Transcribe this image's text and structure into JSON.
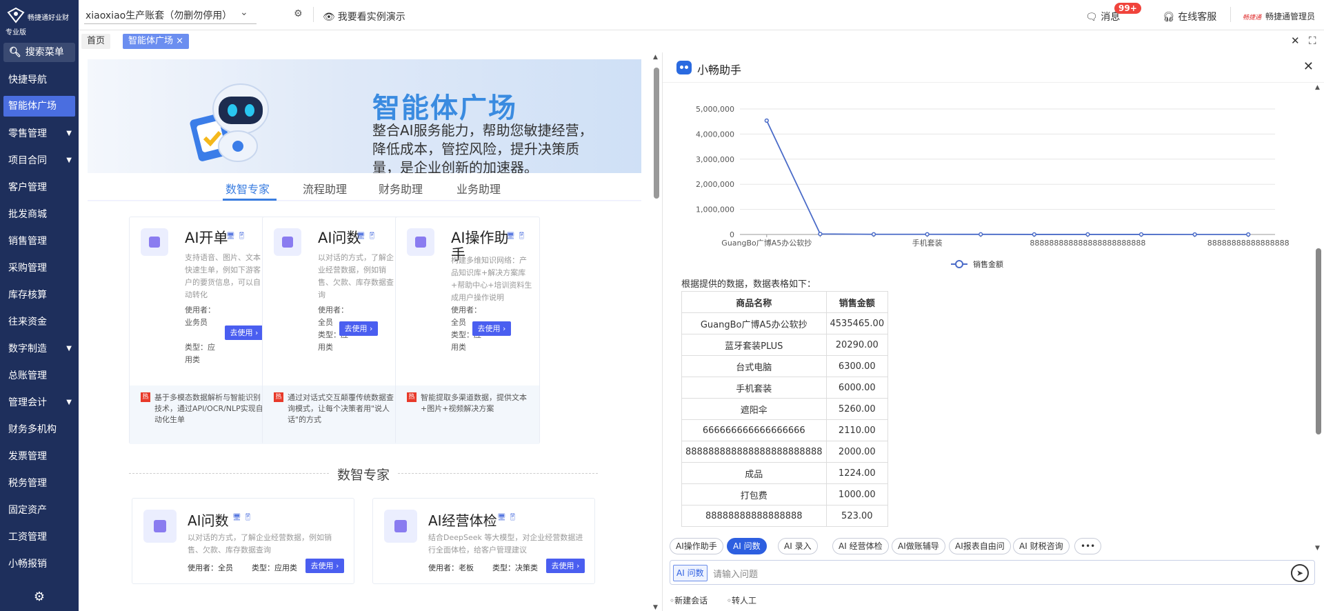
{
  "sidebar": {
    "brand": "畅捷通好业财",
    "edition": "专业版",
    "search_label": "搜索菜单",
    "items": [
      {
        "label": "快捷导航",
        "has_caret": false
      },
      {
        "label": "智能体广场",
        "has_caret": false
      },
      {
        "label": "零售管理",
        "has_caret": true
      },
      {
        "label": "项目合同",
        "has_caret": true
      },
      {
        "label": "客户管理",
        "has_caret": false
      },
      {
        "label": "批发商城",
        "has_caret": false
      },
      {
        "label": "销售管理",
        "has_caret": false
      },
      {
        "label": "采购管理",
        "has_caret": false
      },
      {
        "label": "库存核算",
        "has_caret": false
      },
      {
        "label": "往来资金",
        "has_caret": false
      },
      {
        "label": "数字制造",
        "has_caret": true
      },
      {
        "label": "总账管理",
        "has_caret": false
      },
      {
        "label": "管理会计",
        "has_caret": true
      },
      {
        "label": "财务多机构",
        "has_caret": false
      },
      {
        "label": "发票管理",
        "has_caret": false
      },
      {
        "label": "税务管理",
        "has_caret": false
      },
      {
        "label": "固定资产",
        "has_caret": false
      },
      {
        "label": "工资管理",
        "has_caret": false
      },
      {
        "label": "小畅报销",
        "has_caret": false
      }
    ]
  },
  "topbar": {
    "account": "xiaoxiao生产账套（勿删勿停用）",
    "demo": "我要看实例演示",
    "messages": "消息",
    "messages_badge": "99+",
    "service": "在线客服",
    "user_logo": "畅捷通",
    "user": "畅捷通管理员"
  },
  "tabs": {
    "home": "首页",
    "active": "智能体广场"
  },
  "banner": {
    "title": "智能体广场",
    "desc": "整合AI服务能力，帮助您敏捷经营，降低成本，管控风险，提升决策质量，是企业创新的加速器。"
  },
  "subtabs": [
    "数智专家",
    "流程助理",
    "财务助理",
    "业务助理"
  ],
  "cards": [
    {
      "title": "AI开单",
      "desc": "支持语音、图片、文本快速生单，例如下游客户的要货信息，可以自动转化",
      "user": "使用者：业务员",
      "type": "类型：应用类",
      "use": "去使用",
      "hot": "基于多模态数据解析与智能识别技术，通过API/OCR/NLP实现自动化生单"
    },
    {
      "title": "AI问数",
      "desc": "以对话的方式，了解企业经营数据，例如销售、欠款、库存数据查询",
      "user": "使用者：全员",
      "type": "类型：应用类",
      "use": "去使用",
      "hot": "通过对话式交互颠覆传统数据查询模式，让每个决策者用\"说人话\"的方式"
    },
    {
      "title": "AI操作助手",
      "desc": "构建多维知识网络：产品知识库+解决方案库+帮助中心+培训资料生成用户操作说明",
      "user": "使用者：全员",
      "type": "类型：应用类",
      "use": "去使用",
      "hot": "智能提取多渠道数据，提供文本+图片+视频解决方案"
    }
  ],
  "section_title": "数智专家",
  "cards2": [
    {
      "title": "AI问数",
      "desc": "以对话的方式，了解企业经营数据，例如销售、欠款、库存数据查询",
      "user": "使用者：全员",
      "type": "类型：应用类",
      "use": "去使用"
    },
    {
      "title": "AI经营体检",
      "desc": "结合DeepSeek 等大模型，对企业经营数据进行全面体检，给客户管理建议",
      "user": "使用者：老板",
      "type": "类型：决策类",
      "use": "去使用"
    }
  ],
  "assistant": {
    "title": "小畅助手",
    "intro": "根据提供的数据，数据表格如下：",
    "table_headers": [
      "商品名称",
      "销售金额"
    ],
    "table_rows": [
      [
        "GuangBo广博A5办公软抄",
        "4535465.00"
      ],
      [
        "蓝牙套装PLUS",
        "20290.00"
      ],
      [
        "台式电脑",
        "6300.00"
      ],
      [
        "手机套装",
        "6000.00"
      ],
      [
        "遮阳伞",
        "5260.00"
      ],
      [
        "666666666666666666",
        "2110.00"
      ],
      [
        "888888888888888888888888",
        "2000.00"
      ],
      [
        "成品",
        "1224.00"
      ],
      [
        "打包费",
        "1000.00"
      ],
      [
        "88888888888888888",
        "523.00"
      ]
    ],
    "quick_buttons": [
      {
        "label": "AI操作助手",
        "on": false
      },
      {
        "label": "AI 问数",
        "on": true
      },
      {
        "label": "AI 录入",
        "on": false
      },
      {
        "label": "AI 经营体检",
        "on": false
      },
      {
        "label": "AI做账辅导",
        "on": false
      },
      {
        "label": "AI报表自由问",
        "on": false
      },
      {
        "label": "AI 财税咨询",
        "on": false
      },
      {
        "label": "•••",
        "on": false
      }
    ],
    "input_tag": "AI 问数",
    "input_placeholder": "请输入问题",
    "new_chat": "新建会话",
    "transfer": "转人工"
  },
  "chart_data": {
    "type": "line",
    "title": "",
    "categories": [
      "GuangBo广博A5办公软抄",
      "蓝牙套装PLUS",
      "台式电脑",
      "手机套装",
      "遮阳伞",
      "666666666666666666",
      "888888888888888888888888",
      "成品",
      "打包费",
      "88888888888888888"
    ],
    "x_tick_labels": [
      "GuangBo广博A5办公软抄",
      "手机套装",
      "888888888888888888888888",
      "88888888888888888"
    ],
    "series": [
      {
        "name": "销售金额",
        "values": [
          4535465,
          20290,
          6300,
          6000,
          5260,
          2110,
          2000,
          1224,
          1000,
          523
        ],
        "color": "#4a6bc8"
      }
    ],
    "y_ticks": [
      "0",
      "1,000,000",
      "2,000,000",
      "3,000,000",
      "4,000,000",
      "5,000,000"
    ],
    "ylim": [
      0,
      5000000
    ],
    "grid": true,
    "legend": "bottom"
  },
  "colors": {
    "sidebar": "#1e2f5c",
    "accent": "#4a6ee0",
    "button": "#4a5ef0",
    "badge": "#f0443c"
  }
}
